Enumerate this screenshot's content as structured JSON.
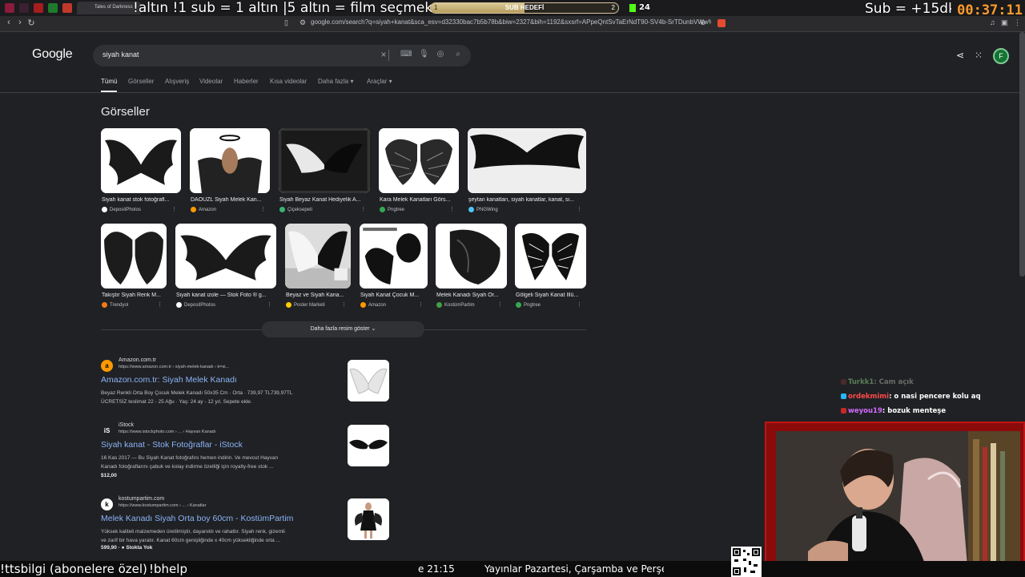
{
  "overlay": {
    "top_text": "!altın   !1 sub = 1 altın  |5 altın = film seçmek",
    "goal_label": "SUB HEDEFİ",
    "goal_left": "1",
    "goal_right": "2",
    "goal_progress": 0.5,
    "viewer_count": "24",
    "sub_promo": "Sub = +15dk",
    "timer": "00:37:11",
    "tab_game_title": "Tales of Darkness",
    "bottom_left": "!ttsbilgi (abonelere özel)",
    "bottom_help": "!bhelp",
    "bottom_time": "e 21:15",
    "bottom_schedule": "Yayınlar Pazartesi, Çarşamba ve Perşembe"
  },
  "browser": {
    "url": "google.com/search?q=siyah+kanat&sca_esv=d32330bac7b5b78b&biw=2327&bih=1192&sxsrf=APpeQntSvTaErNdT90-SV4b-SrTDunbVWw%3A1787271..."
  },
  "google": {
    "logo": "Google",
    "query": "siyah kanat",
    "tabs": [
      "Tümü",
      "Görseller",
      "Alışveriş",
      "Videolar",
      "Haberler",
      "Kısa videolar",
      "Daha fazla ▾",
      "Araçlar ▾"
    ],
    "avatar_letter": "F",
    "images_heading": "Görseller",
    "images_row1": [
      {
        "caption": "Siyah kanat stok fotoğrafl...",
        "source": "DepositPhotos",
        "color": "#ffffff"
      },
      {
        "caption": "DAOUZL Siyah Melek Kan...",
        "source": "Amazon",
        "color": "#ff9900"
      },
      {
        "caption": "Siyah Beyaz Kanat Hediyelik A...",
        "source": "Çiçeksepeti",
        "color": "#3cb371"
      },
      {
        "caption": "Kara Melek Kanatları Görs...",
        "source": "Pngtree",
        "color": "#34a853"
      },
      {
        "caption": "şeytan kanatları, siyah kanatlar, kanat, si...",
        "source": "PNGWing",
        "color": "#4fc3f7"
      }
    ],
    "images_row2": [
      {
        "caption": "Takıştır Siyah Renk M...",
        "source": "Trendyol",
        "color": "#f27a1a"
      },
      {
        "caption": "Siyah kanat izole — Stok Foto ® g...",
        "source": "DepositPhotos",
        "color": "#ffffff"
      },
      {
        "caption": "Beyaz ve Siyah Kana...",
        "source": "Poster Marketi",
        "color": "#ffcc00"
      },
      {
        "caption": "Siyah Kanat Çocuk M...",
        "source": "Amazon",
        "color": "#ff9900"
      },
      {
        "caption": "Melek Kanadı Siyah Or...",
        "source": "KostümPartim",
        "color": "#43a047"
      },
      {
        "caption": "Gölgeli Siyah Kanat İllü...",
        "source": "Pngtree",
        "color": "#34a853"
      }
    ],
    "more_images": "Daha fazla resim göster ⌄",
    "results": [
      {
        "site": "Amazon.com.tr",
        "url": "https://www.amazon.com.tr › siyah-melek-kanadı › k=si...",
        "title": "Amazon.com.tr: Siyah Melek Kanadı",
        "snippet_1": "Beyaz Renkli Orta Boy Çocuk Melek Kanadı 50x35 Cm · Orta · 739,97 TL739,97TL",
        "snippet_2": "ÜCRETSİZ teslimat 22 - 25 Ağu · Yaş: 24 ay - 12 yıl. Sepete ekle.",
        "fav": "a",
        "extra": ""
      },
      {
        "site": "iStock",
        "url": "https://www.istockphoto.com › ... › Hayvan Kanadı",
        "title": "Siyah kanat - Stok Fotoğraflar - iStock",
        "snippet_1": "16 Kas 2017 — Bu Siyah Kanat fotoğrafını hemen indirin. Ve mevcut Hayvan",
        "snippet_2": "Kanadı fotoğraflarını çabuk ve kolay indirme özelliği için royalty-free stok ...",
        "fav": "iS",
        "extra": "$12,00"
      },
      {
        "site": "kostumpartim.com",
        "url": "https://www.kostumpartim.com › ... › Kanatlar",
        "title": "Melek Kanadı Siyah Orta boy 60cm - KostümPartim",
        "snippet_1": "Yüksek kaliteli malzemeden üretilmiştir, dayanıklı ve rahattır. Siyah renk, gizemli",
        "snippet_2": "ve zarif bir hava yaratır. Kanat 60cm genişliğinde x 40cm yüksekliğinde orta ...",
        "fav": "k",
        "extra": "599,90 · ● Stokta Yok"
      }
    ]
  },
  "chat": [
    {
      "user": "Turkk1",
      "msg": ": Cam açık",
      "color": "#5a7d5a"
    },
    {
      "user": "ordekmimi",
      "msg": ": o nasi pencere kolu aq",
      "color": "#ff4a4a"
    },
    {
      "user": "weyou19",
      "msg": ": bozuk menteşe",
      "color": "#d36bff"
    }
  ],
  "colors": {
    "accent": "#8ab4f8",
    "bg": "#202124",
    "timer": "#ff9a2e"
  }
}
